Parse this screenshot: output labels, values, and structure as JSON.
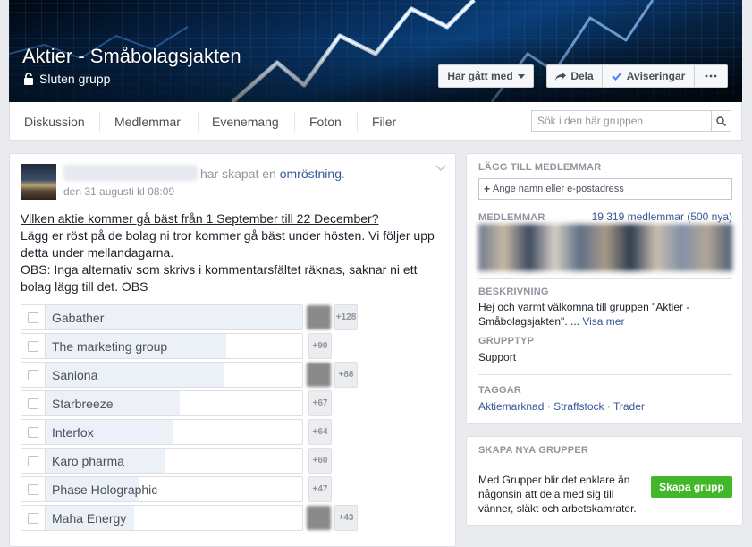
{
  "cover": {
    "title": "Aktier - Småbolagsjakten",
    "privacy": "Sluten grupp",
    "joined_label": "Har gått med",
    "share_label": "Dela",
    "notifications_label": "Aviseringar"
  },
  "nav": {
    "tabs": [
      "Diskussion",
      "Medlemmar",
      "Evenemang",
      "Foton",
      "Filer"
    ],
    "search_placeholder": "Sök i den här gruppen"
  },
  "post": {
    "action_text": "har skapat en",
    "action_link": "omröstning",
    "action_end": ".",
    "date": "den 31 augusti kl 08:09",
    "question": "Vilken aktie kommer gå bäst från 1 September till 22 December?",
    "body": "Lägg er röst på de bolag ni tror kommer gå bäst under hösten. Vi följer upp detta under mellandagarna.",
    "note": "OBS: Inga alternativ som skrivs i kommentarsfältet räknas, saknar ni ett bolag lägg till det. OBS",
    "poll_options": [
      {
        "label": "Gabather",
        "votes": 129,
        "extra": "+128",
        "voters": 1
      },
      {
        "label": "The marketing group",
        "votes": 90,
        "extra": "+90",
        "voters": 0
      },
      {
        "label": "Saniona",
        "votes": 89,
        "extra": "+88",
        "voters": 1
      },
      {
        "label": "Starbreeze",
        "votes": 67,
        "extra": "+67",
        "voters": 0
      },
      {
        "label": "Interfox",
        "votes": 64,
        "extra": "+64",
        "voters": 0
      },
      {
        "label": "Karo pharma",
        "votes": 60,
        "extra": "+60",
        "voters": 0
      },
      {
        "label": "Phase Holographic",
        "votes": 47,
        "extra": "+47",
        "voters": 0
      },
      {
        "label": "Maha Energy",
        "votes": 44,
        "extra": "+43",
        "voters": 1
      }
    ]
  },
  "sidebar": {
    "add_members_heading": "LÄGG TILL MEDLEMMAR",
    "add_members_placeholder": "Ange namn eller e-postadress",
    "members_heading": "MEDLEMMAR",
    "members_count": "19 319 medlemmar (500 nya)",
    "description_heading": "BESKRIVNING",
    "description": "Hej och varmt välkomna till gruppen \"Aktier - Småbolagsjakten\". ...",
    "see_more": "Visa mer",
    "group_type_heading": "GRUPPTYP",
    "group_type": "Support",
    "tags_heading": "TAGGAR",
    "tags": [
      "Aktiemarknad",
      "Straffstock",
      "Trader"
    ],
    "create_heading": "SKAPA NYA GRUPPER",
    "create_text": "Med Grupper blir det enklare än någonsin att dela med sig till vänner, släkt och arbetskamrater.",
    "create_button": "Skapa grupp"
  },
  "colors": {
    "link": "#365899",
    "poll_fill": "#ecf0f7",
    "create_button": "#42b72a"
  }
}
